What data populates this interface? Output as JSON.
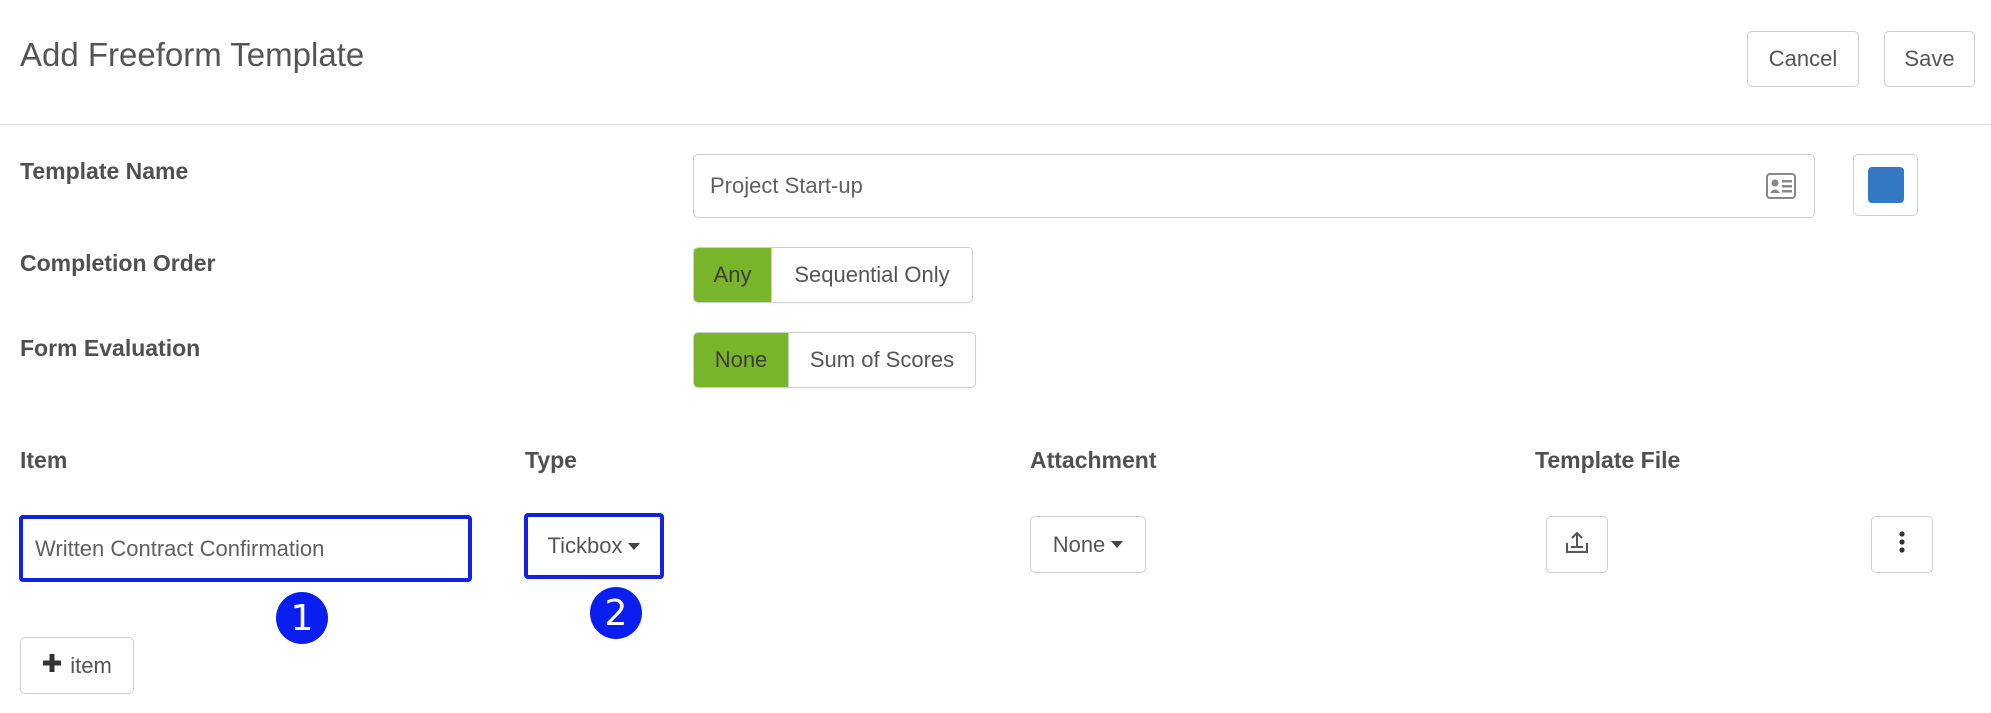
{
  "header": {
    "title": "Add Freeform Template",
    "cancel_label": "Cancel",
    "save_label": "Save"
  },
  "form": {
    "template_name_label": "Template Name",
    "template_name_value": "Project Start-up",
    "color_swatch": "#3478c4",
    "completion_order_label": "Completion Order",
    "completion_order_options": [
      "Any",
      "Sequential Only"
    ],
    "completion_order_selected": "Any",
    "form_evaluation_label": "Form Evaluation",
    "form_evaluation_options": [
      "None",
      "Sum of Scores"
    ],
    "form_evaluation_selected": "None"
  },
  "items_table": {
    "columns": [
      "Item",
      "Type",
      "Attachment",
      "Template File"
    ],
    "rows": [
      {
        "item": "Written Contract Confirmation",
        "type": "Tickbox",
        "attachment": "None"
      }
    ],
    "add_item_label": "item"
  },
  "annotations": [
    "1",
    "2"
  ],
  "colors": {
    "accent_green": "#79b52b",
    "highlight_blue": "#1122e0",
    "badge_blue": "#0b1ef0"
  }
}
